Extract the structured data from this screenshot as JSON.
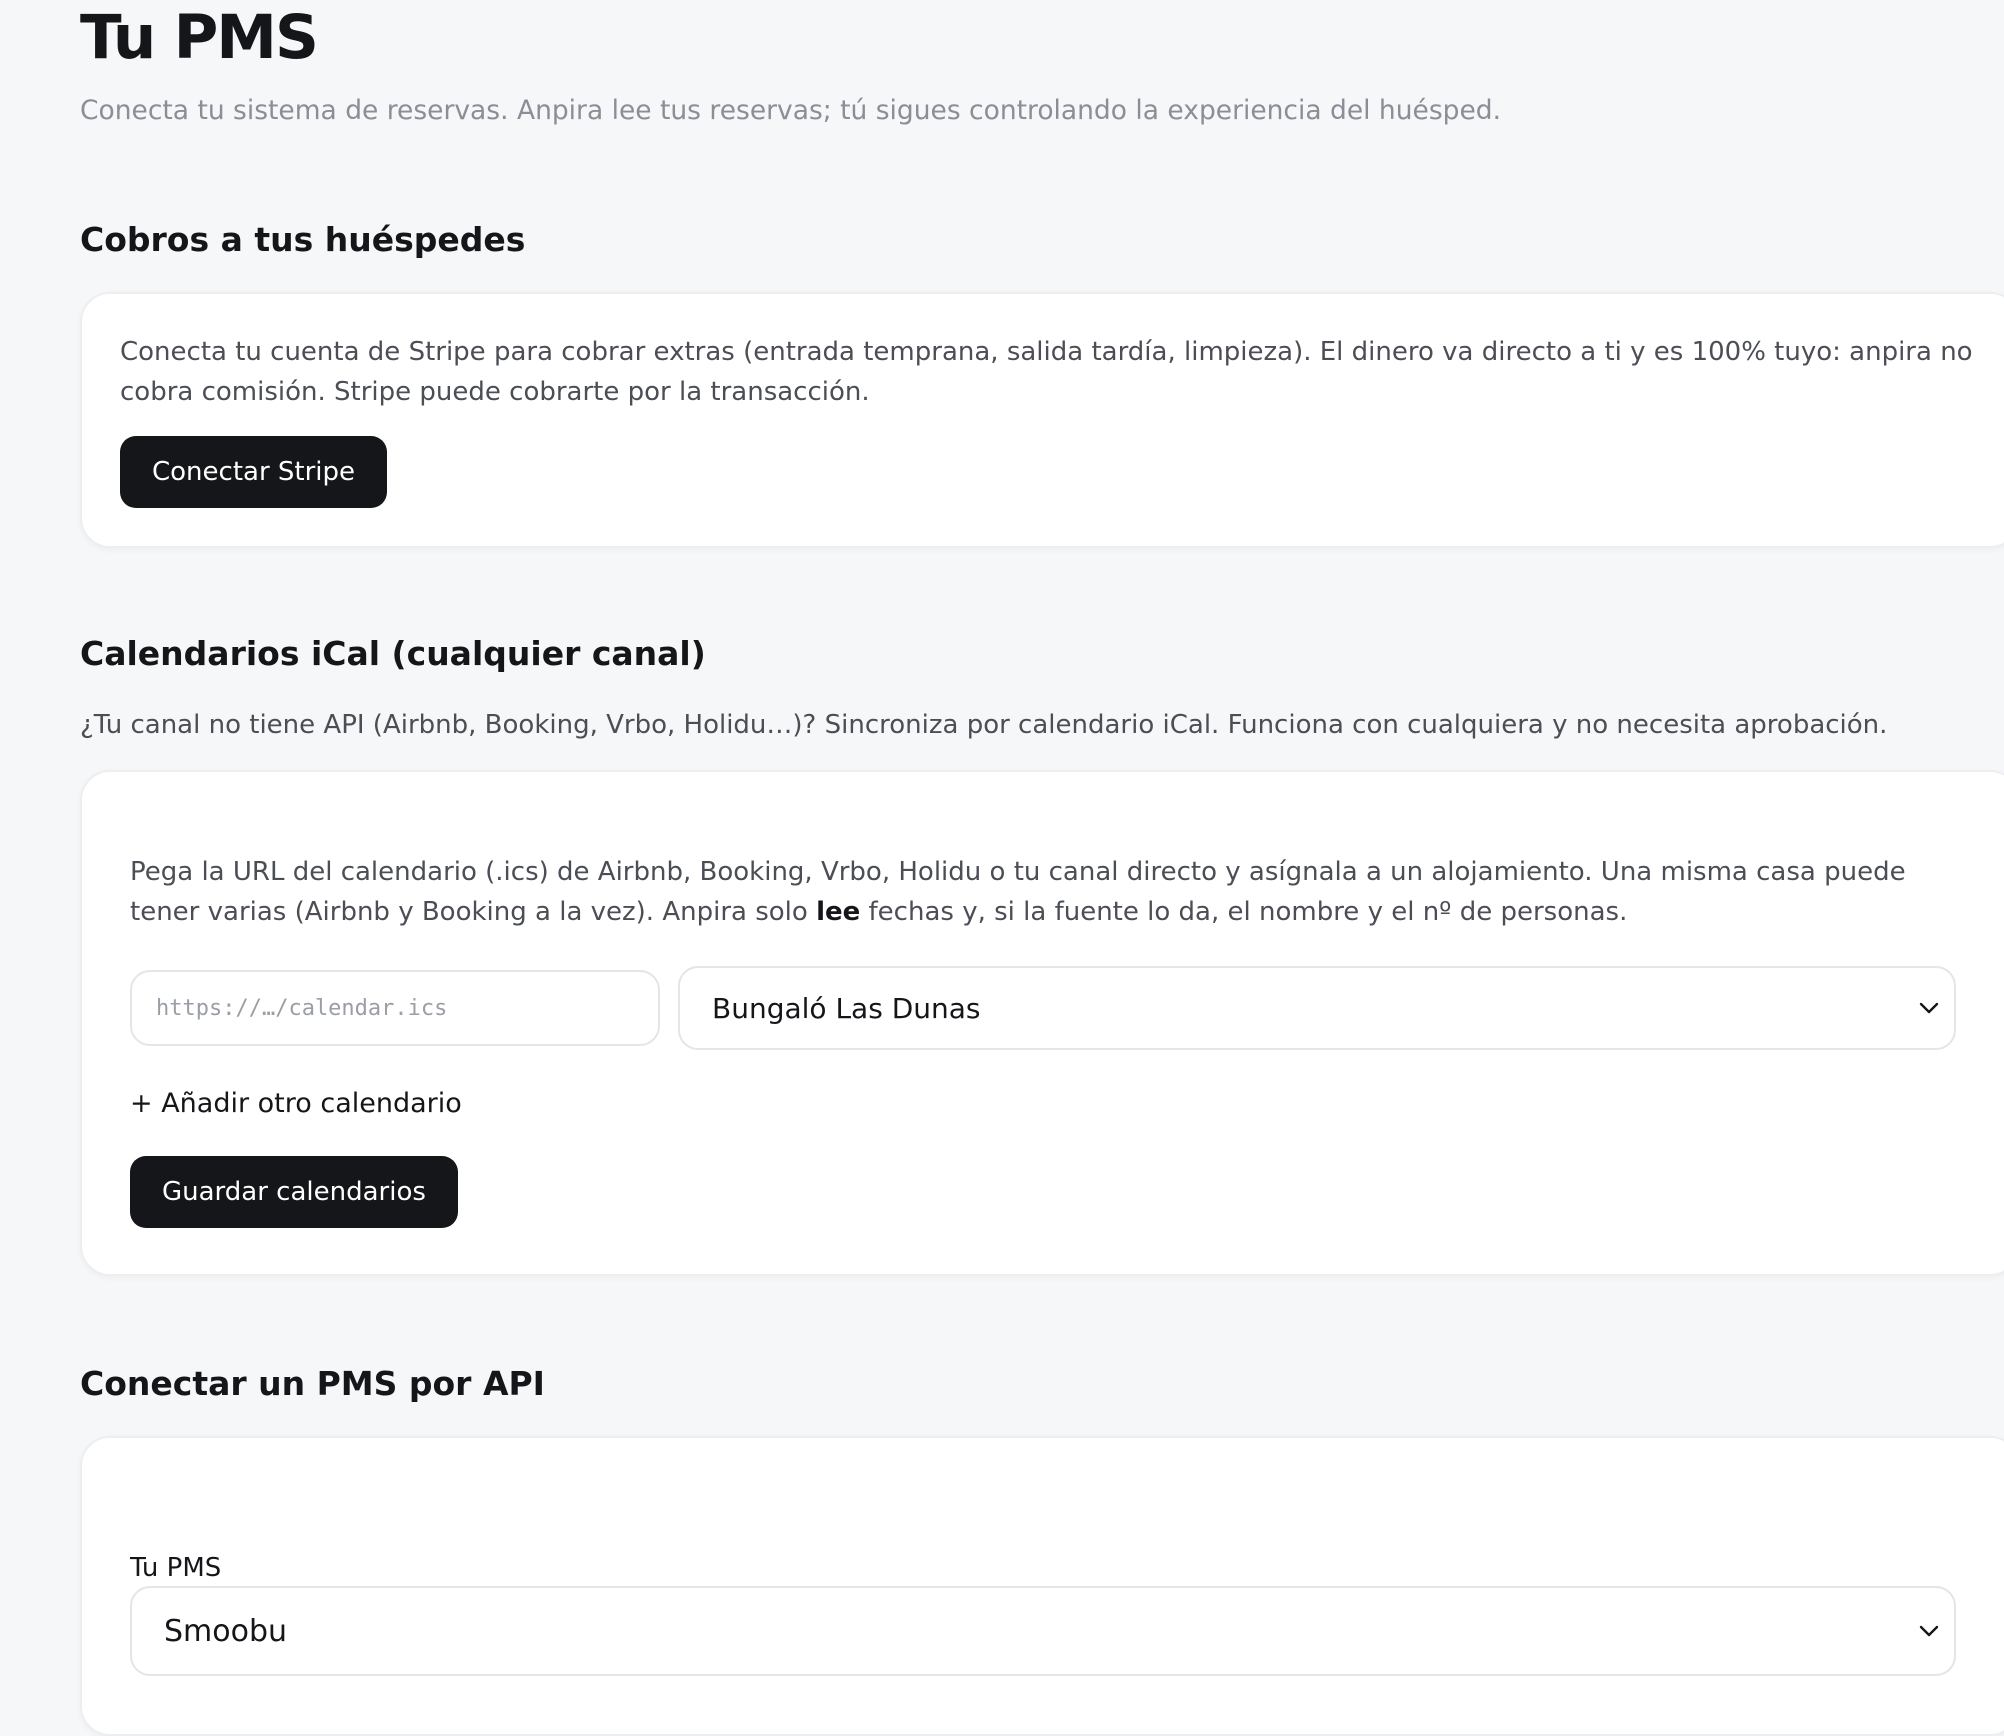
{
  "page": {
    "title": "Tu PMS",
    "subtitle": "Conecta tu sistema de reservas. Anpira lee tus reservas; tú sigues controlando la experiencia del huésped."
  },
  "payments": {
    "heading": "Cobros a tus huéspedes",
    "description": "Conecta tu cuenta de Stripe para cobrar extras (entrada temprana, salida tardía, limpieza). El dinero va directo a ti y es 100% tuyo: anpira no cobra comisión. Stripe puede cobrarte por la transacción.",
    "connect_button": "Conectar Stripe"
  },
  "ical": {
    "heading": "Calendarios iCal (cualquier canal)",
    "description": "¿Tu canal no tiene API (Airbnb, Booking, Vrbo, Holidu…)? Sincroniza por calendario iCal. Funciona con cualquiera y no necesita aprobación.",
    "instructions_before": "Pega la URL del calendario (.ics) de Airbnb, Booking, Vrbo, Holidu o tu canal directo y asígnala a un alojamiento. Una misma casa puede tener varias (Airbnb y Booking a la vez). Anpira solo ",
    "instructions_bold": "lee",
    "instructions_after": " fechas y, si la fuente lo da, el nombre y el nº de personas.",
    "url_input": {
      "value": "",
      "placeholder": "https://…/calendar.ics"
    },
    "property_select": {
      "selected": "Bungaló Las Dunas"
    },
    "add_link": "+ Añadir otro calendario",
    "save_button": "Guardar calendarios"
  },
  "api": {
    "heading": "Conectar un PMS por API",
    "pms_label": "Tu PMS",
    "pms_select": {
      "selected": "Smoobu"
    }
  },
  "icons": {
    "select_chevron": "chevron-down-icon"
  },
  "colors": {
    "background": "#f6f7f8",
    "card": "#ffffff",
    "primary_button": "#15161a",
    "muted_text": "#8a8e96"
  }
}
